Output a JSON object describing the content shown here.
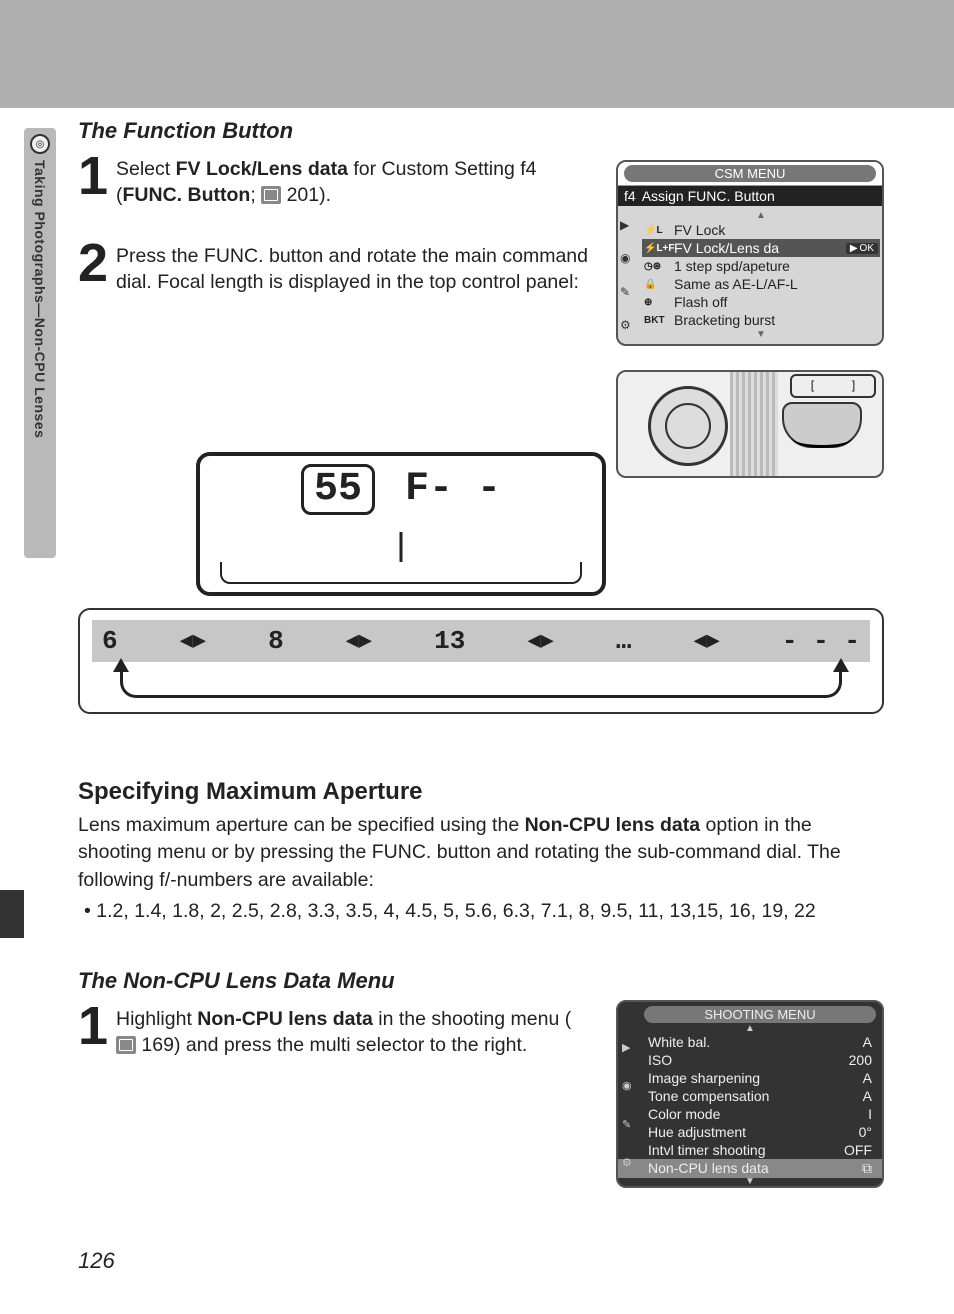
{
  "page_number": "126",
  "side_tab_text": "Taking Photographs—Non-CPU Lenses",
  "section1": {
    "title": "The Function Button",
    "step1_pre": "Select ",
    "step1_bold1": "FV Lock/Lens data",
    "step1_mid": " for Custom Setting f4 (",
    "step1_bold2": "FUNC. Button",
    "step1_post": "; ",
    "step1_ref": "201",
    "step1_end": ").",
    "step2": "Press the FUNC. button and rotate the main command dial.  Focal length is displayed in the top control panel:"
  },
  "csm": {
    "title": "CSM MENU",
    "sub_prefix": "f4",
    "sub": "Assign FUNC. Button",
    "items": [
      {
        "icon": "⚡L",
        "label": "FV Lock"
      },
      {
        "icon": "⚡L+F",
        "label": "FV Lock/Lens da",
        "ok": "OK"
      },
      {
        "icon": "◷⊛",
        "label": "1 step spd/apeture"
      },
      {
        "icon": "🔒",
        "label": "Same as AE-L/AF-L"
      },
      {
        "icon": "⊕",
        "label": "Flash off"
      },
      {
        "icon": "BKT",
        "label": "Bracketing burst"
      }
    ]
  },
  "cam_topwin": {
    "a": "[",
    "b": "]"
  },
  "lcd": {
    "focal": "55",
    "f": "F- -"
  },
  "strip": {
    "v1": "6",
    "v2": "8",
    "v3": "13",
    "v4": "…",
    "v5": "- - -"
  },
  "spec": {
    "heading": "Specifying Maximum Aperture",
    "para": "Lens maximum aperture can be specified using the Non-CPU lens data option in the shooting menu or by pressing the FUNC. button and rotating the sub-command dial.  The following f/-numbers are available:",
    "para_bold": "Non-CPU lens data",
    "bullet": "• 1.2, 1.4, 1.8, 2, 2.5, 2.8, 3.3, 3.5, 4, 4.5, 5, 5.6, 6.3, 7.1, 8, 9.5, 11, 13,15, 16, 19, 22"
  },
  "noncpu": {
    "title": "The Non-CPU Lens Data Menu",
    "step1_pre": "Highlight ",
    "step1_bold": "Non-CPU lens data",
    "step1_mid": " in the shooting menu (",
    "step1_ref": "169",
    "step1_post": ") and press the multi selector to the right."
  },
  "shoot": {
    "title": "SHOOTING MENU",
    "rows": [
      {
        "l": "White bal.",
        "v": "A"
      },
      {
        "l": "ISO",
        "v": "200"
      },
      {
        "l": "Image sharpening",
        "v": "A"
      },
      {
        "l": "Tone compensation",
        "v": "A"
      },
      {
        "l": "Color mode",
        "v": "I"
      },
      {
        "l": "Hue adjustment",
        "v": "0°"
      },
      {
        "l": "Intvl timer shooting",
        "v": "OFF"
      },
      {
        "l": "Non-CPU lens data",
        "v": "⧉"
      }
    ],
    "highlight_index": 7
  }
}
